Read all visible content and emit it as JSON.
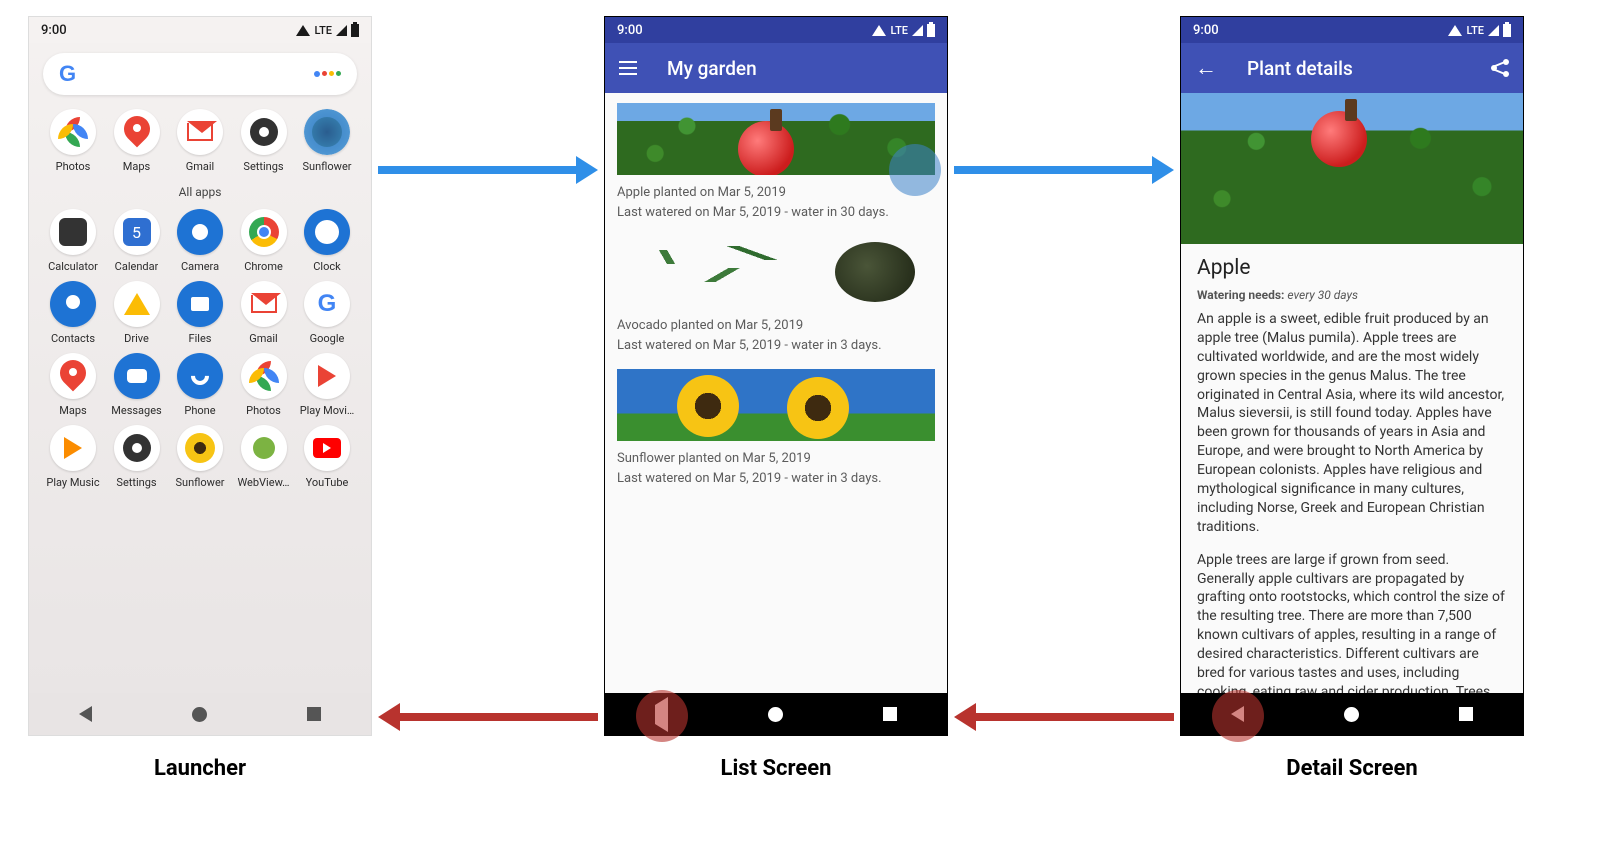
{
  "captions": {
    "launcher": "Launcher",
    "list": "List Screen",
    "detail": "Detail Screen"
  },
  "status": {
    "time": "9:00",
    "lte": "LTE"
  },
  "launcher": {
    "section_label": "All apps",
    "row_top": [
      "Photos",
      "Maps",
      "Gmail",
      "Settings",
      "Sunflower"
    ],
    "rows": [
      [
        "Calculator",
        "Calendar",
        "Camera",
        "Chrome",
        "Clock"
      ],
      [
        "Contacts",
        "Drive",
        "Files",
        "Gmail",
        "Google"
      ],
      [
        "Maps",
        "Messages",
        "Phone",
        "Photos",
        "Play Movi…"
      ],
      [
        "Play Music",
        "Settings",
        "Sunflower",
        "WebView…",
        "YouTube"
      ]
    ]
  },
  "list": {
    "title": "My garden",
    "items": [
      {
        "planted": "Apple planted on Mar 5, 2019",
        "watered": "Last watered on Mar 5, 2019 - water in 30 days."
      },
      {
        "planted": "Avocado planted on Mar 5, 2019",
        "watered": "Last watered on Mar 5, 2019 - water in 3 days."
      },
      {
        "planted": "Sunflower planted on Mar 5, 2019",
        "watered": "Last watered on Mar 5, 2019 - water in 3 days."
      }
    ]
  },
  "detail": {
    "title": "Plant details",
    "heading": "Apple",
    "watering_label": "Watering needs:",
    "watering_value": "every 30 days",
    "para1": "An apple is a sweet, edible fruit produced by an apple tree (Malus pumila). Apple trees are cultivated worldwide, and are the most widely grown species in the genus Malus. The tree originated in Central Asia, where its wild ancestor, Malus sieversii, is still found today. Apples have been grown for thousands of years in Asia and Europe, and were brought to North America by European colonists. Apples have religious and mythological significance in many cultures, including Norse, Greek and European Christian traditions.",
    "para2": "Apple trees are large if grown from seed. Generally apple cultivars are propagated by grafting onto rootstocks, which control the size of the resulting tree. There are more than 7,500 known cultivars of apples, resulting in a range of desired characteristics. Different cultivars are bred for various tastes and uses, including cooking, eating raw and cider production. Trees and fruit"
  }
}
